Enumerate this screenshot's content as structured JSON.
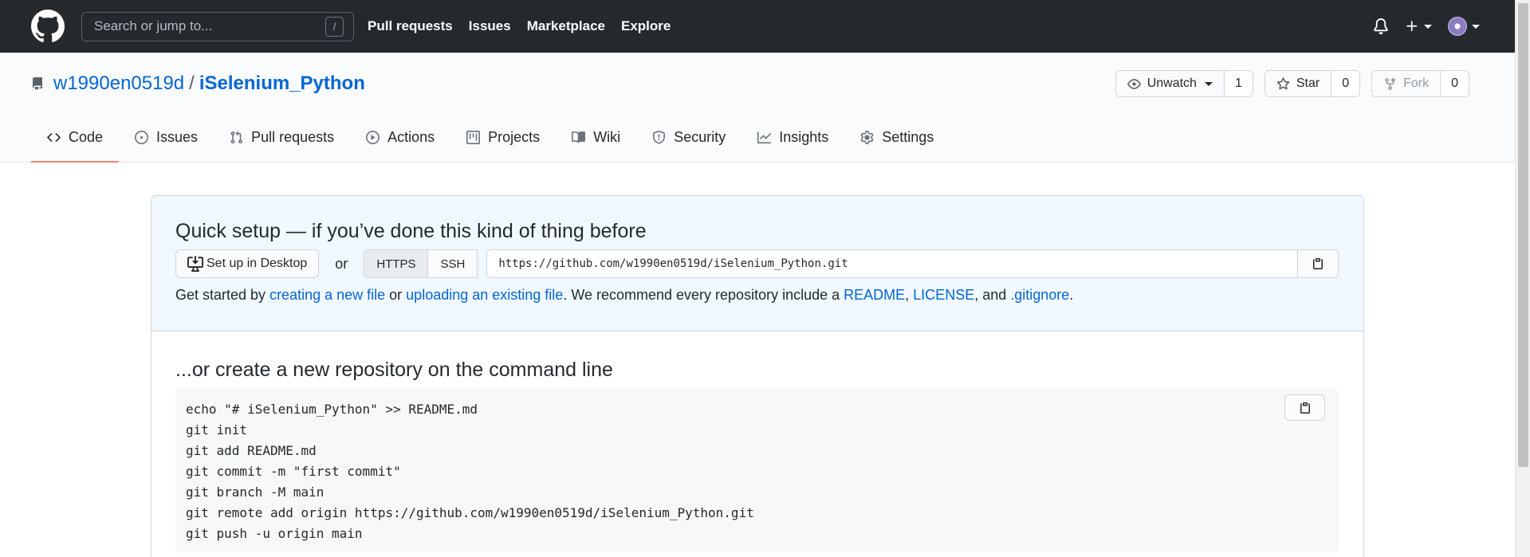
{
  "topbar": {
    "search_placeholder": "Search or jump to...",
    "search_key": "/",
    "nav": [
      "Pull requests",
      "Issues",
      "Marketplace",
      "Explore"
    ]
  },
  "repo": {
    "owner": "w1990en0519d",
    "separator": "/",
    "name": "iSelenium_Python",
    "watch_label": "Unwatch",
    "watch_count": "1",
    "star_label": "Star",
    "star_count": "0",
    "fork_label": "Fork",
    "fork_count": "0"
  },
  "tabs": [
    {
      "label": "Code",
      "icon": "code-icon",
      "active": true
    },
    {
      "label": "Issues",
      "icon": "issue-icon"
    },
    {
      "label": "Pull requests",
      "icon": "pull-request-icon"
    },
    {
      "label": "Actions",
      "icon": "play-icon"
    },
    {
      "label": "Projects",
      "icon": "project-icon"
    },
    {
      "label": "Wiki",
      "icon": "book-icon"
    },
    {
      "label": "Security",
      "icon": "shield-icon"
    },
    {
      "label": "Insights",
      "icon": "graph-icon"
    },
    {
      "label": "Settings",
      "icon": "gear-icon"
    }
  ],
  "quick_setup": {
    "title": "Quick setup — if you’ve done this kind of thing before",
    "desktop_label": "Set up in Desktop",
    "or": "or",
    "https_label": "HTTPS",
    "ssh_label": "SSH",
    "clone_url": "https://github.com/w1990en0519d/iSelenium_Python.git",
    "intro": {
      "t1": "Get started by ",
      "l1": "creating a new file",
      "t2": " or ",
      "l2": "uploading an existing file",
      "t3": ". We recommend every repository include a ",
      "l3": "README",
      "t4": ", ",
      "l4": "LICENSE",
      "t5": ", and ",
      "l5": ".gitignore",
      "t6": "."
    }
  },
  "command_line": {
    "title": "...or create a new repository on the command line",
    "lines": [
      "echo \"# iSelenium_Python\" >> README.md",
      "git init",
      "git add README.md",
      "git commit -m \"first commit\"",
      "git branch -M main",
      "git remote add origin https://github.com/w1990en0519d/iSelenium_Python.git",
      "git push -u origin main"
    ]
  },
  "colors": {
    "header_bg": "#24292e",
    "link": "#0366d6",
    "active_tab_underline": "#f9826c",
    "quick_setup_bg": "#f1f8ff"
  }
}
